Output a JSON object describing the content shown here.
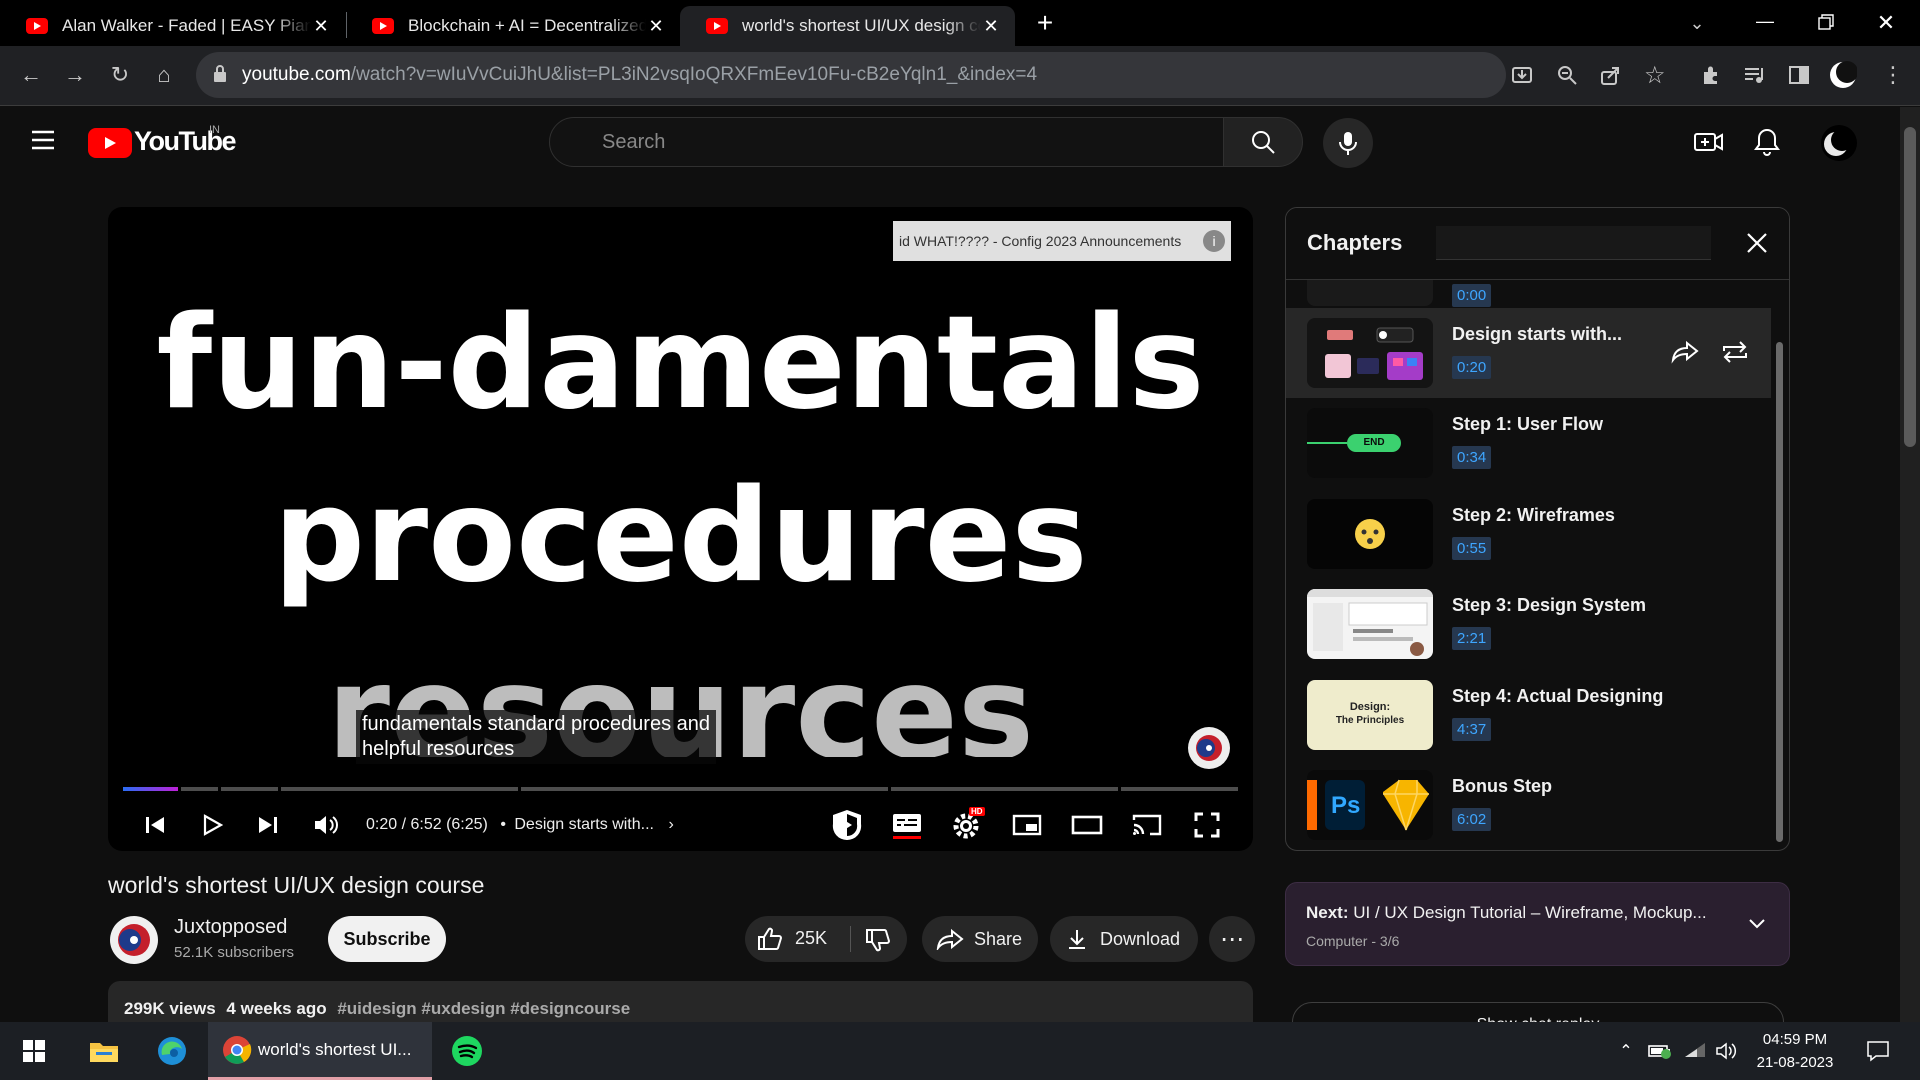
{
  "browser": {
    "tabs": [
      {
        "title": "Alan Walker - Faded | EASY Piano",
        "active": false
      },
      {
        "title": "Blockchain + AI = Decentralized AI",
        "active": false
      },
      {
        "title": "world's shortest UI/UX design course",
        "active": true
      }
    ],
    "url_host": "youtube.com",
    "url_path": "/watch?v=wIuVvCuiJhU&list=PL3iN2vsqIoQRXFmEev10Fu-cB2eYqln1_&index=4"
  },
  "youtube": {
    "logo_text": "YouTube",
    "country_code": "IN",
    "search_placeholder": "Search"
  },
  "player": {
    "slide_lines": [
      "fun-damentals",
      "procedures",
      "resources"
    ],
    "caption_line1": "fundamentals standard procedures and",
    "caption_line2": "helpful resources",
    "endcard_text": "id WHAT!???? - Config 2023 Announcements",
    "time_text": "0:20 / 6:52 (6:25)",
    "chapter_text": "Design starts with...",
    "progress": 0.049,
    "settings_badge": "HD"
  },
  "video": {
    "title": "world's shortest UI/UX design course",
    "channel_name": "Juxtopposed",
    "subscribers": "52.1K subscribers",
    "subscribe_label": "Subscribe",
    "likes": "25K",
    "share_label": "Share",
    "download_label": "Download",
    "views": "299K views",
    "age": "4 weeks ago",
    "hashtags": "#uidesign #uxdesign #designcourse"
  },
  "chapters": {
    "heading": "Chapters",
    "partial_time": "0:00",
    "items": [
      {
        "name": "Design starts with...",
        "time": "0:20",
        "active": true
      },
      {
        "name": "Step 1: User Flow",
        "time": "0:34",
        "active": false
      },
      {
        "name": "Step 2: Wireframes",
        "time": "0:55",
        "active": false
      },
      {
        "name": "Step 3: Design System",
        "time": "2:21",
        "active": false
      },
      {
        "name": "Step 4: Actual Designing",
        "time": "4:37",
        "active": false
      },
      {
        "name": "Bonus Step",
        "time": "6:02",
        "active": false
      }
    ],
    "thumb_end_label": "END",
    "thumb_design_label": "Design:",
    "thumb_principles_label": "The Principles",
    "thumb_ps_label": "Ps"
  },
  "next_up": {
    "label": "Next:",
    "title": "UI / UX Design Tutorial – Wireframe, Mockup...",
    "playlist": "Computer - 3/6"
  },
  "live_chat": {
    "label": "Show chat replay"
  },
  "taskbar": {
    "chrome_window": "world's shortest UI...",
    "time": "04:59 PM",
    "date": "21-08-2023"
  }
}
